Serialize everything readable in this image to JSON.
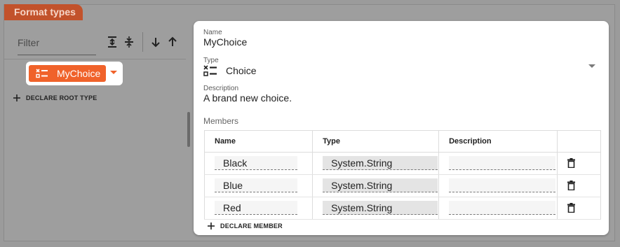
{
  "panel": {
    "title": "Format types"
  },
  "left": {
    "filter_placeholder": "Filter",
    "toolbar": [
      "expand-all-icon",
      "collapse-all-icon",
      "sort-descending-icon",
      "sort-ascending-icon"
    ],
    "tree": [
      {
        "label": "MyChoice",
        "icon": "choice-icon",
        "selected": true
      }
    ],
    "declare_root_label": "DECLARE ROOT TYPE"
  },
  "detail": {
    "name_label": "Name",
    "name_value": "MyChoice",
    "type_label": "Type",
    "type_value": "Choice",
    "type_icon": "choice-icon",
    "description_label": "Description",
    "description_value": "A brand new choice.",
    "members_label": "Members",
    "table": {
      "columns": [
        "Name",
        "Type",
        "Description"
      ],
      "rows": [
        {
          "name": "Black",
          "type": "System.String",
          "description": ""
        },
        {
          "name": "Blue",
          "type": "System.String",
          "description": ""
        },
        {
          "name": "Red",
          "type": "System.String",
          "description": ""
        }
      ]
    },
    "declare_member_label": "DECLARE MEMBER"
  },
  "colors": {
    "accent": "#f0622a",
    "panel_tab": "#c2522b",
    "overlay": "#9e9e9e"
  }
}
